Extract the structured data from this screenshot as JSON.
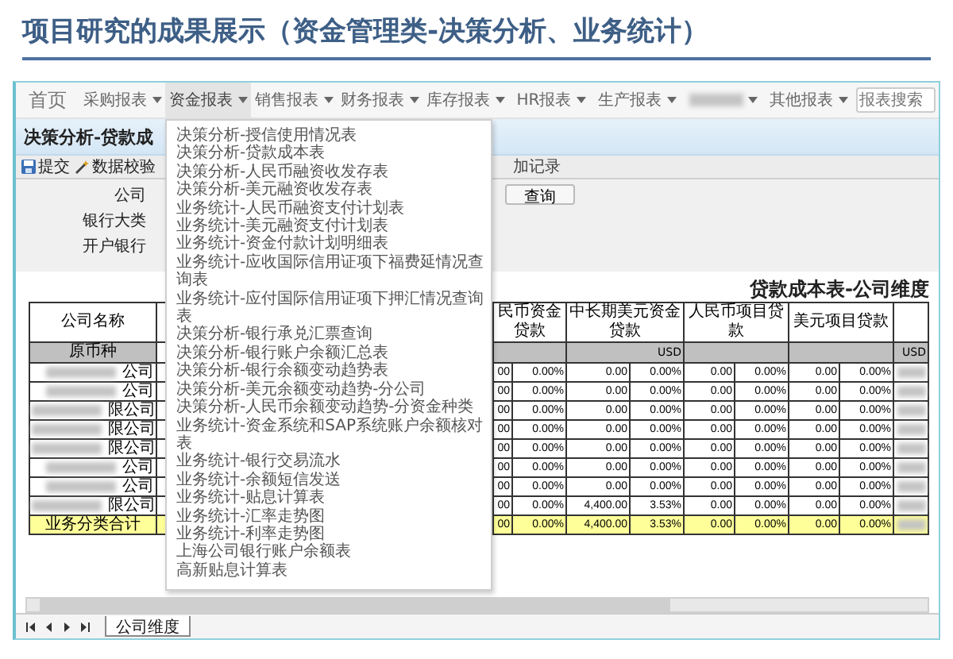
{
  "slide_title": "项目研究的成果展示（资金管理类-决策分析、业务统计）",
  "nav": {
    "items": [
      {
        "kind": "home",
        "label": "首页",
        "selected": false
      },
      {
        "kind": "menu",
        "label": "采购报表",
        "selected": false
      },
      {
        "kind": "menu",
        "label": "资金报表",
        "selected": true
      },
      {
        "kind": "menu",
        "label": "销售报表",
        "selected": false
      },
      {
        "kind": "menu",
        "label": "财务报表",
        "selected": false
      },
      {
        "kind": "menu",
        "label": "库存报表",
        "selected": false
      },
      {
        "kind": "menu",
        "label": "HR报表",
        "selected": false
      },
      {
        "kind": "menu",
        "label": "生产报表",
        "selected": false
      },
      {
        "kind": "redacted",
        "selected": false
      },
      {
        "kind": "menu",
        "label": "其他报表",
        "selected": false
      }
    ],
    "search": {
      "placeholder": "报表搜索"
    }
  },
  "dropdown": {
    "items": [
      "决策分析-授信使用情况表",
      "决策分析-贷款成本表",
      "决策分析-人民币融资收发存表",
      "决策分析-美元融资收发存表",
      "业务统计-人民币融资支付计划表",
      "业务统计-美元融资支付计划表",
      "业务统计-资金付款计划明细表",
      "业务统计-应收国际信用证项下福费延情况查询表",
      "业务统计-应付国际信用证项下押汇情况查询表",
      "决策分析-银行承兑汇票查询",
      "决策分析-银行账户余额汇总表",
      "决策分析-银行余额变动趋势表",
      "决策分析-美元余额变动趋势-分公司",
      "决策分析-人民币余额变动趋势-分资金种类",
      "业务统计-资金系统和SAP系统账户余额核对表",
      "业务统计-银行交易流水",
      "业务统计-余额短信发送",
      "业务统计-贴息计算表",
      "业务统计-汇率走势图",
      "业务统计-利率走势图",
      "上海公司银行账户余额表",
      "高新贴息计算表"
    ]
  },
  "page_title": "决策分析-贷款成",
  "toolbar": [
    {
      "kind": "save",
      "label": "提交"
    },
    {
      "kind": "validate",
      "label": "数据校验"
    },
    {
      "kind": "text",
      "label": "加记录"
    }
  ],
  "form": {
    "labels": [
      "公司",
      "银行大类",
      "开户银行"
    ],
    "query_button": "查询"
  },
  "report": {
    "title": "贷款成本表-公司维度",
    "name_header": "公司名称",
    "currency_header": "原币种",
    "groups": [
      {
        "kind": "pair",
        "label": "民币资金贷款"
      },
      {
        "kind": "pair",
        "label": "中长期美元资金贷款",
        "currency": "USD"
      },
      {
        "kind": "pair",
        "label": "人民币项目贷款"
      },
      {
        "kind": "pair",
        "label": "美元项目贷款"
      },
      {
        "kind": "single",
        "currency": "USD"
      }
    ],
    "rows": [
      {
        "name_suffix": "公司",
        "cells": [
          "00",
          "0.00%",
          "0.00",
          "0.00%",
          "0.00",
          "0.00%",
          "0.00",
          "0.00%"
        ]
      },
      {
        "name_suffix": "公司",
        "cells": [
          "00",
          "0.00%",
          "0.00",
          "0.00%",
          "0.00",
          "0.00%",
          "0.00",
          "0.00%"
        ]
      },
      {
        "name_suffix": "限公司",
        "cells": [
          "00",
          "0.00%",
          "0.00",
          "0.00%",
          "0.00",
          "0.00%",
          "0.00",
          "0.00%"
        ]
      },
      {
        "name_suffix": "限公司",
        "cells": [
          "00",
          "0.00%",
          "0.00",
          "0.00%",
          "0.00",
          "0.00%",
          "0.00",
          "0.00%"
        ]
      },
      {
        "name_suffix": "限公司",
        "cells": [
          "00",
          "0.00%",
          "0.00",
          "0.00%",
          "0.00",
          "0.00%",
          "0.00",
          "0.00%"
        ]
      },
      {
        "name_suffix": "公司",
        "cells": [
          "00",
          "0.00%",
          "0.00",
          "0.00%",
          "0.00",
          "0.00%",
          "0.00",
          "0.00%"
        ]
      },
      {
        "name_suffix": "公司",
        "cells": [
          "00",
          "0.00%",
          "0.00",
          "0.00%",
          "0.00",
          "0.00%",
          "0.00",
          "0.00%"
        ]
      },
      {
        "name_suffix": "限公司",
        "cells": [
          "00",
          "0.00%",
          "4,400.00",
          "3.53%",
          "0.00",
          "0.00%",
          "0.00",
          "0.00%"
        ]
      }
    ],
    "total": {
      "label": "业务分类合计",
      "cells": [
        "00",
        "0.00%",
        "4,400.00",
        "3.53%",
        "0.00",
        "0.00%",
        "0.00",
        "0.00%"
      ]
    }
  },
  "sheet_tabs": [
    {
      "label": "公司维度",
      "selected": true
    }
  ]
}
